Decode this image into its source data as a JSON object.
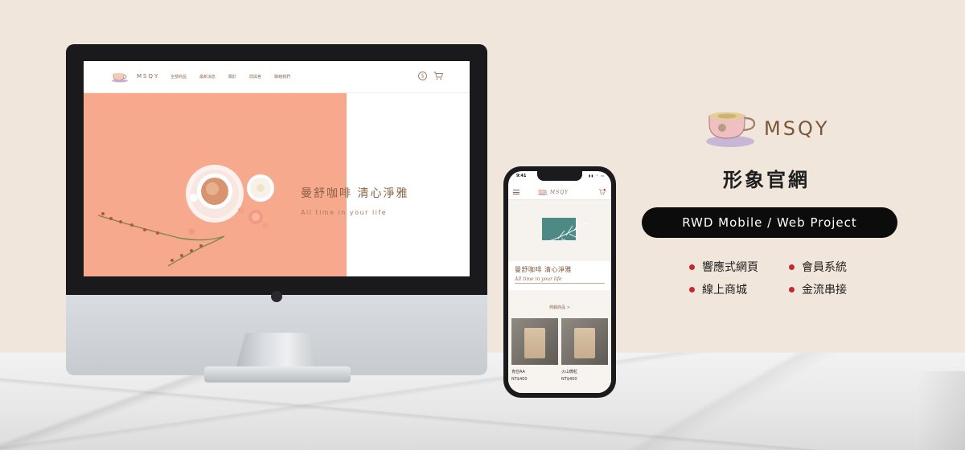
{
  "colors": {
    "background": "#f1e6dc",
    "hero_peach": "#f6a98c",
    "brown_text": "#7b5638",
    "accent_red": "#c4292c",
    "pill_bg": "#0c0c0c"
  },
  "desktop_site": {
    "logo": "MSQY",
    "nav": [
      "全部商品",
      "最新消息",
      "關於",
      "問與答",
      "聯絡我們"
    ],
    "icons": [
      "user-icon",
      "cart-icon"
    ],
    "hero": {
      "title": "曼舒咖啡  清心淨雅",
      "subtitle": "All time in your life"
    }
  },
  "mobile_site": {
    "status_time": "9:41",
    "logo": "MSQY",
    "title": "曼舒咖啡  清心淨雅",
    "subtitle": "All time in your life",
    "section_title": "熱銷商品 >",
    "products": [
      {
        "name": "肯亞AA",
        "price": "NT$400"
      },
      {
        "name": "火山微粒",
        "price": "NT$400"
      }
    ]
  },
  "brand": {
    "name": "MSQY",
    "title": "形象官網",
    "pill": "RWD Mobile / Web Project",
    "features": [
      "響應式網頁",
      "會員系統",
      "線上商城",
      "金流串接"
    ]
  }
}
